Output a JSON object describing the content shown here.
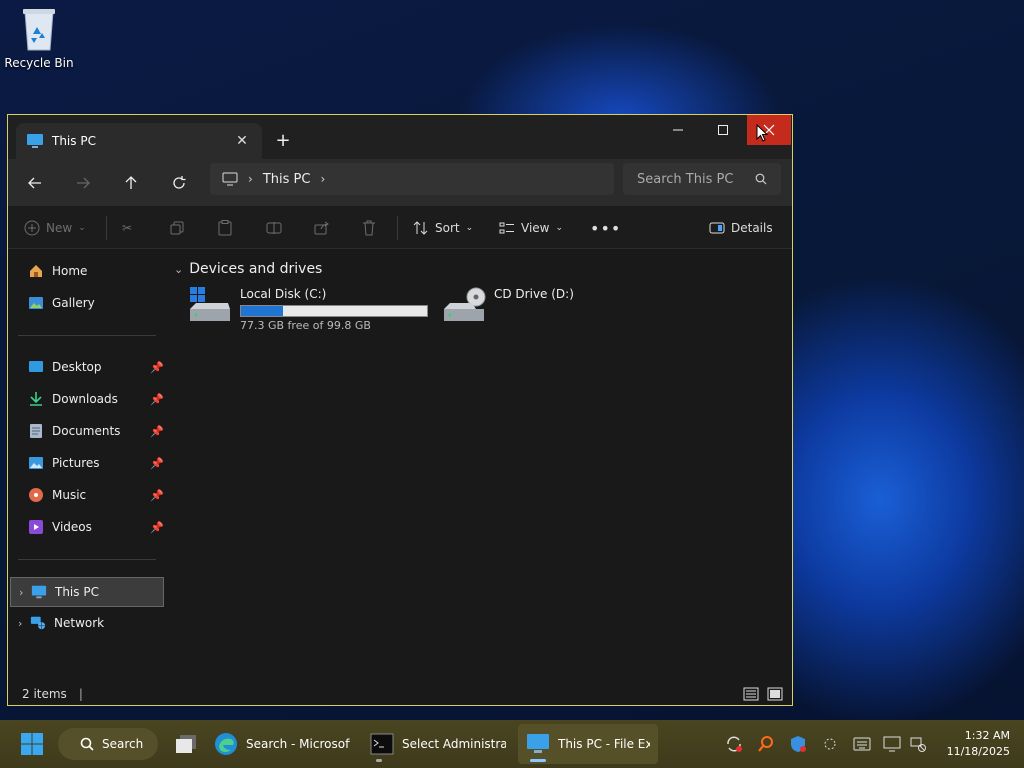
{
  "desktop": {
    "recycle_bin_label": "Recycle Bin"
  },
  "window": {
    "tab_title": "This PC",
    "breadcrumb": [
      "This PC"
    ],
    "search_placeholder": "Search This PC"
  },
  "commandbar": {
    "new_label": "New",
    "sort_label": "Sort",
    "view_label": "View",
    "details_label": "Details"
  },
  "sidebar": {
    "home": "Home",
    "gallery": "Gallery",
    "pinned": [
      {
        "label": "Desktop"
      },
      {
        "label": "Downloads"
      },
      {
        "label": "Documents"
      },
      {
        "label": "Pictures"
      },
      {
        "label": "Music"
      },
      {
        "label": "Videos"
      }
    ],
    "this_pc": "This PC",
    "network": "Network"
  },
  "content": {
    "group_header": "Devices and drives",
    "drives": [
      {
        "name": "Local Disk (C:)",
        "free_text": "77.3 GB free of 99.8 GB",
        "used_fraction": 0.2255
      },
      {
        "name": "CD Drive (D:)"
      }
    ]
  },
  "status": {
    "items": "2 items"
  },
  "taskbar": {
    "search_label": "Search",
    "apps": [
      {
        "label": "Search - Microsoft I"
      },
      {
        "label": "Select Administrato"
      },
      {
        "label": "This PC - File Exp"
      }
    ],
    "time": "1:32 AM",
    "date": "11/18/2025"
  },
  "colors": {
    "accent": "#2075d2",
    "close_red": "#c42b1c",
    "window_bg": "#191919"
  }
}
